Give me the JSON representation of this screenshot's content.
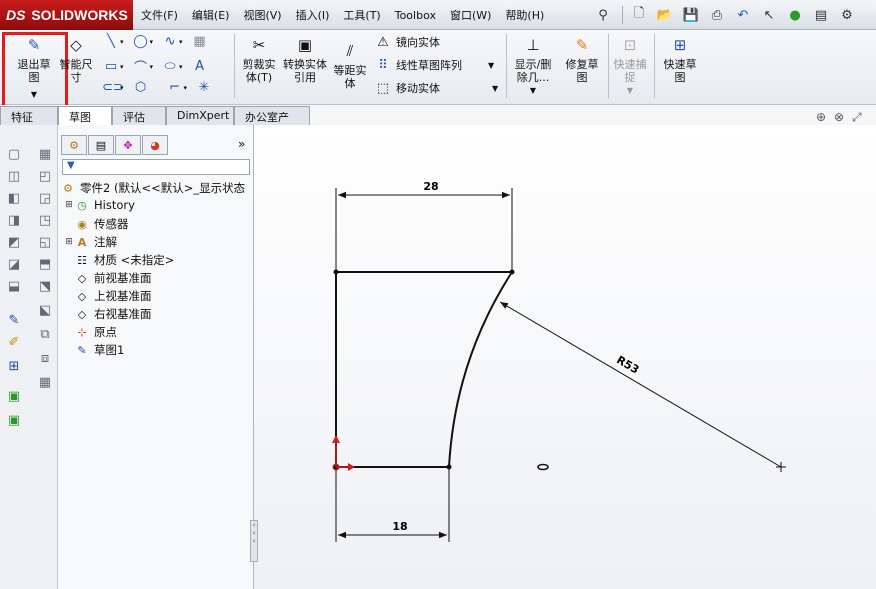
{
  "app": {
    "logo_prefix": "DS",
    "logo_name": "SOLIDWORKS"
  },
  "menu": [
    "文件(F)",
    "编辑(E)",
    "视图(V)",
    "插入(I)",
    "工具(T)",
    "Toolbox",
    "窗口(W)",
    "帮助(H)"
  ],
  "quick_icons": [
    "pin-icon",
    "new-doc-icon",
    "open-icon",
    "save-icon",
    "print-icon",
    "undo-icon",
    "select-icon",
    "rebuild-icon",
    "file-props-icon",
    "options-icon"
  ],
  "ribbon": {
    "exit_sketch": "退出草图",
    "smart_dim": "智能尺寸",
    "trim": "剪裁实体(T)",
    "convert": "转换实体引用",
    "offset": "等距实体",
    "mirror": "镜向实体",
    "linear_pattern": "线性草图阵列",
    "move": "移动实体",
    "show_delete": "显示/删除几...",
    "repair": "修复草图",
    "quick_snap": "快速捕捉",
    "rapid_sketch": "快速草图"
  },
  "tabs": [
    "特征",
    "草图",
    "评估",
    "DimXpert",
    "办公室产品"
  ],
  "active_tab": 1,
  "tree": {
    "part_label": "零件2 (默认<<默认>_显示状态",
    "items": [
      "History",
      "传感器",
      "注解",
      "材质 <未指定>",
      "前视基准面",
      "上视基准面",
      "右视基准面",
      "原点",
      "草图1"
    ]
  },
  "sketch": {
    "dim_top": "28",
    "dim_bottom": "18",
    "dim_radius": "R53"
  },
  "colors": {
    "accent_red": "#e31b1b",
    "origin_red": "#d41a1a",
    "dim_line": "#111111"
  }
}
